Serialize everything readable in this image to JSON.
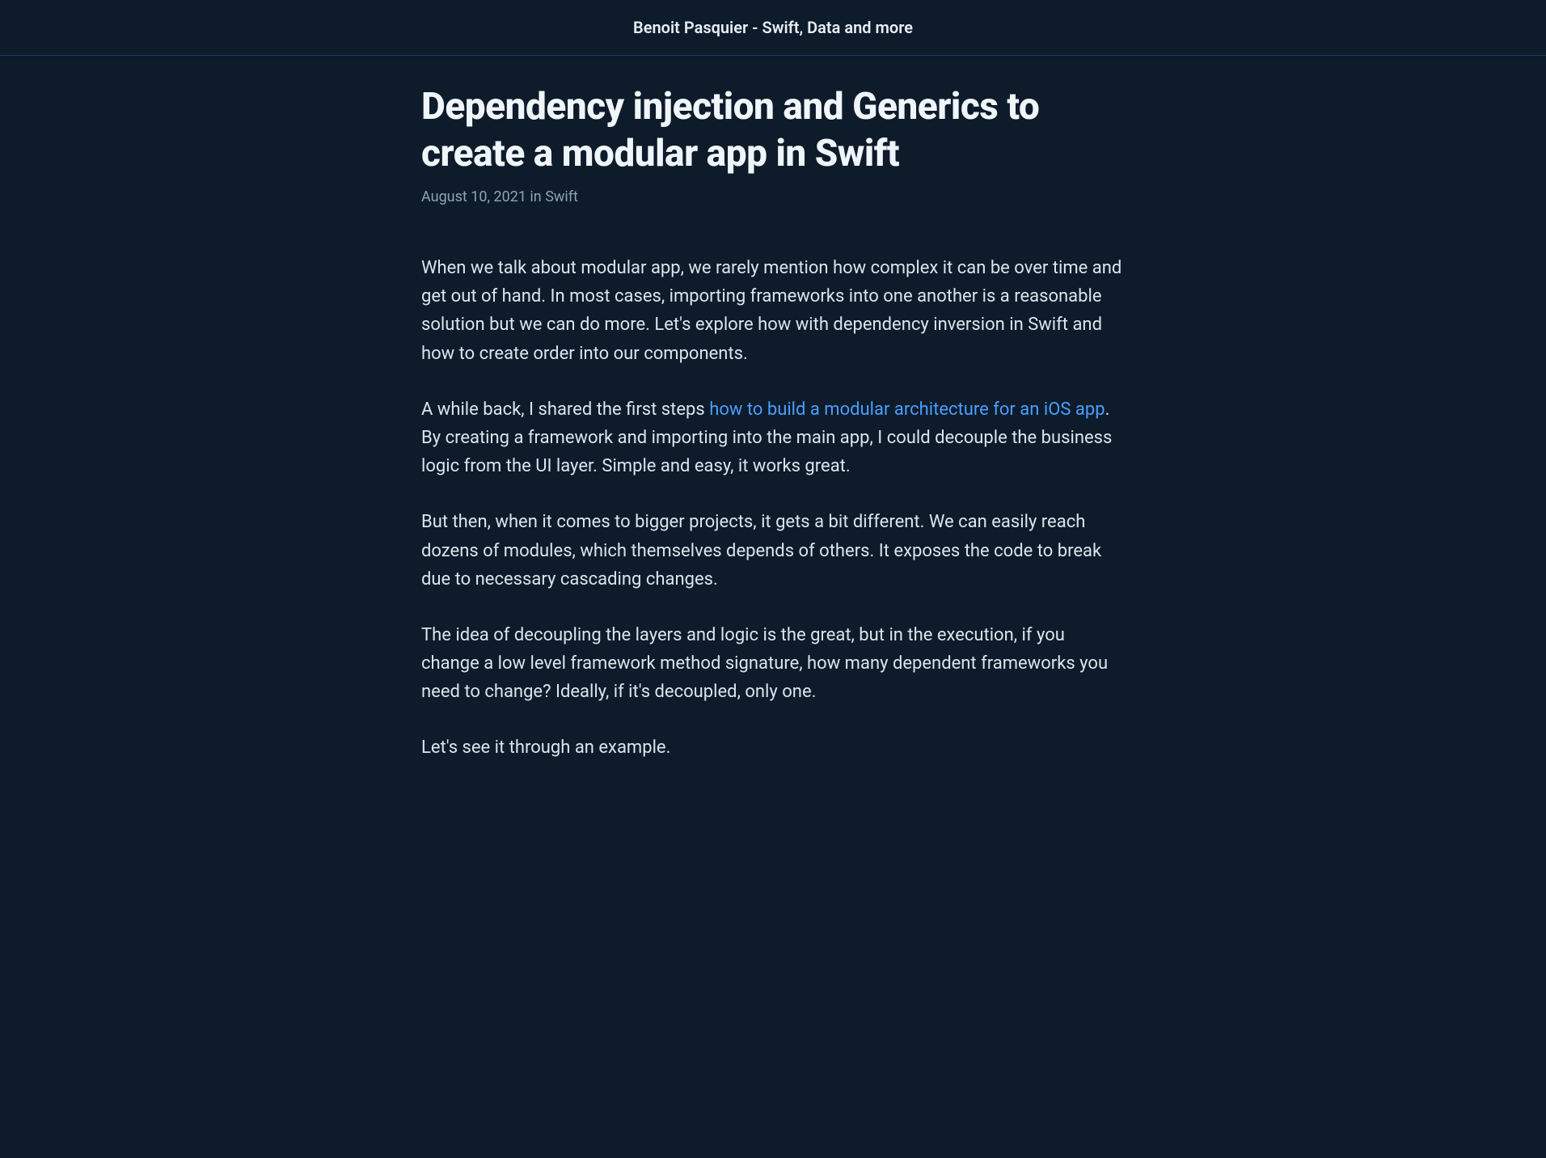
{
  "header": {
    "site_title": "Benoit Pasquier - Swift, Data and more"
  },
  "article": {
    "title": "Dependency injection and Generics to create a modular app in Swift",
    "date": "August 10, 2021",
    "meta_in": " in ",
    "category": "Swift",
    "paragraphs": {
      "p1": "When we talk about modular app, we rarely mention how complex it can be over time and get out of hand. In most cases, importing frameworks into one another is a reasonable solution but we can do more. Let's explore how with dependency inversion in Swift and how to create order into our components.",
      "p2_before": "A while back, I shared the first steps ",
      "p2_link": "how to build a modular architecture for an iOS app",
      "p2_after": ". By creating a framework and importing into the main app, I could decouple the business logic from the UI layer. Simple and easy, it works great.",
      "p3": "But then, when it comes to bigger projects, it gets a bit different. We can easily reach dozens of modules, which themselves depends of others. It exposes the code to break due to necessary cascading changes.",
      "p4": "The idea of decoupling the layers and logic is the great, but in the execution, if you change a low level framework method signature, how many dependent frameworks you need to change? Ideally, if it's decoupled, only one.",
      "p5": "Let's see it through an example."
    }
  }
}
